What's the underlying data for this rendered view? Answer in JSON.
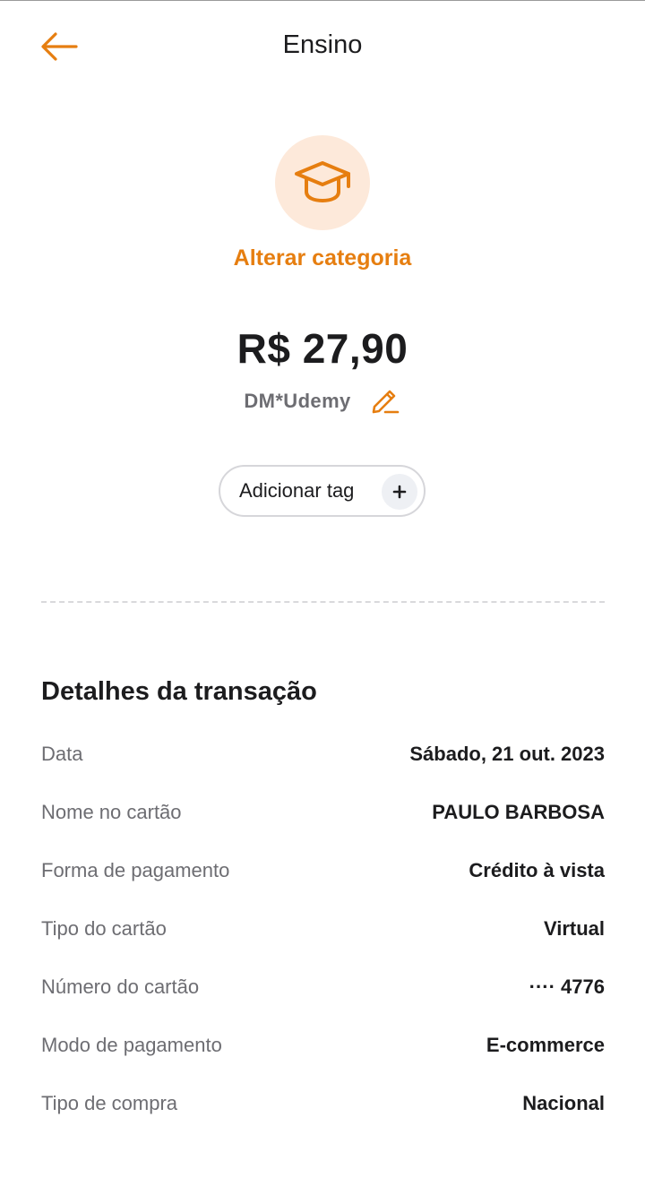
{
  "header": {
    "title": "Ensino",
    "back_icon": "arrow-left-icon"
  },
  "category": {
    "icon": "graduation-cap-icon",
    "change_label": "Alterar categoria"
  },
  "transaction": {
    "amount": "R$ 27,90",
    "merchant": "DM*Udemy",
    "edit_icon": "pencil-icon"
  },
  "tag": {
    "label": "Adicionar tag",
    "icon": "plus-icon"
  },
  "details": {
    "title": "Detalhes da transação",
    "rows": [
      {
        "label": "Data",
        "value": "Sábado, 21 out. 2023"
      },
      {
        "label": "Nome no cartão",
        "value": "PAULO BARBOSA"
      },
      {
        "label": "Forma de pagamento",
        "value": "Crédito à vista"
      },
      {
        "label": "Tipo do cartão",
        "value": "Virtual"
      },
      {
        "label": "Número do cartão",
        "value": "···· 4776"
      },
      {
        "label": "Modo de pagamento",
        "value": "E-commerce"
      },
      {
        "label": "Tipo de compra",
        "value": "Nacional"
      }
    ]
  },
  "colors": {
    "accent": "#e67e10",
    "accent_light": "#fde9da",
    "text_primary": "#1c1c1e",
    "text_secondary": "#6d6d72"
  }
}
